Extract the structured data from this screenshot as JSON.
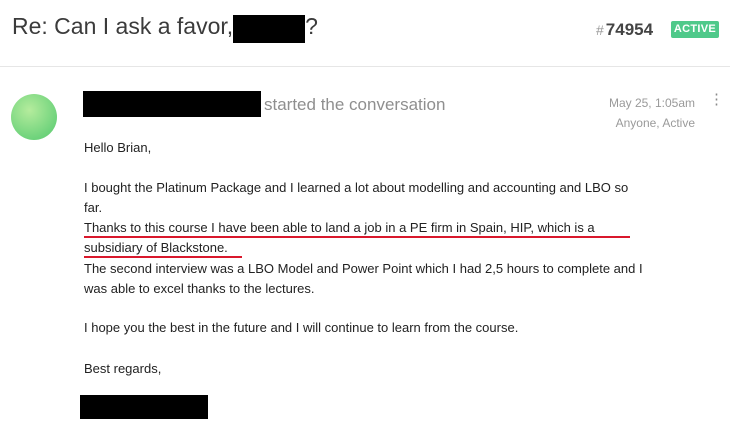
{
  "header": {
    "title_prefix": "Re: Can I ask a favor,",
    "title_suffix": "?",
    "ticket_hash": "#",
    "ticket_number": "74954",
    "status_badge": "ACTIVE",
    "colors": {
      "badge": "#4fc98a",
      "underline": "#d9182c"
    }
  },
  "message": {
    "author_action": "started the conversation",
    "date": "May 25, 1:05am",
    "meta_status": "Anyone, Active",
    "more_icon": "vertical-ellipsis-icon",
    "lines": [
      "Hello Brian,",
      "I bought the Platinum Package and I learned a lot about modelling and accounting and LBO so",
      "far.",
      "Thanks to this course I have been able to land a job in a PE firm in Spain, HIP, which is a",
      "subsidiary of Blackstone.",
      "The second interview was a LBO Model and Power Point which I had 2,5 hours to complete and I",
      "was able to excel thanks to the lectures.",
      "I hope you the best in the future and I will continue to learn from the course.",
      "Best regards,"
    ]
  }
}
